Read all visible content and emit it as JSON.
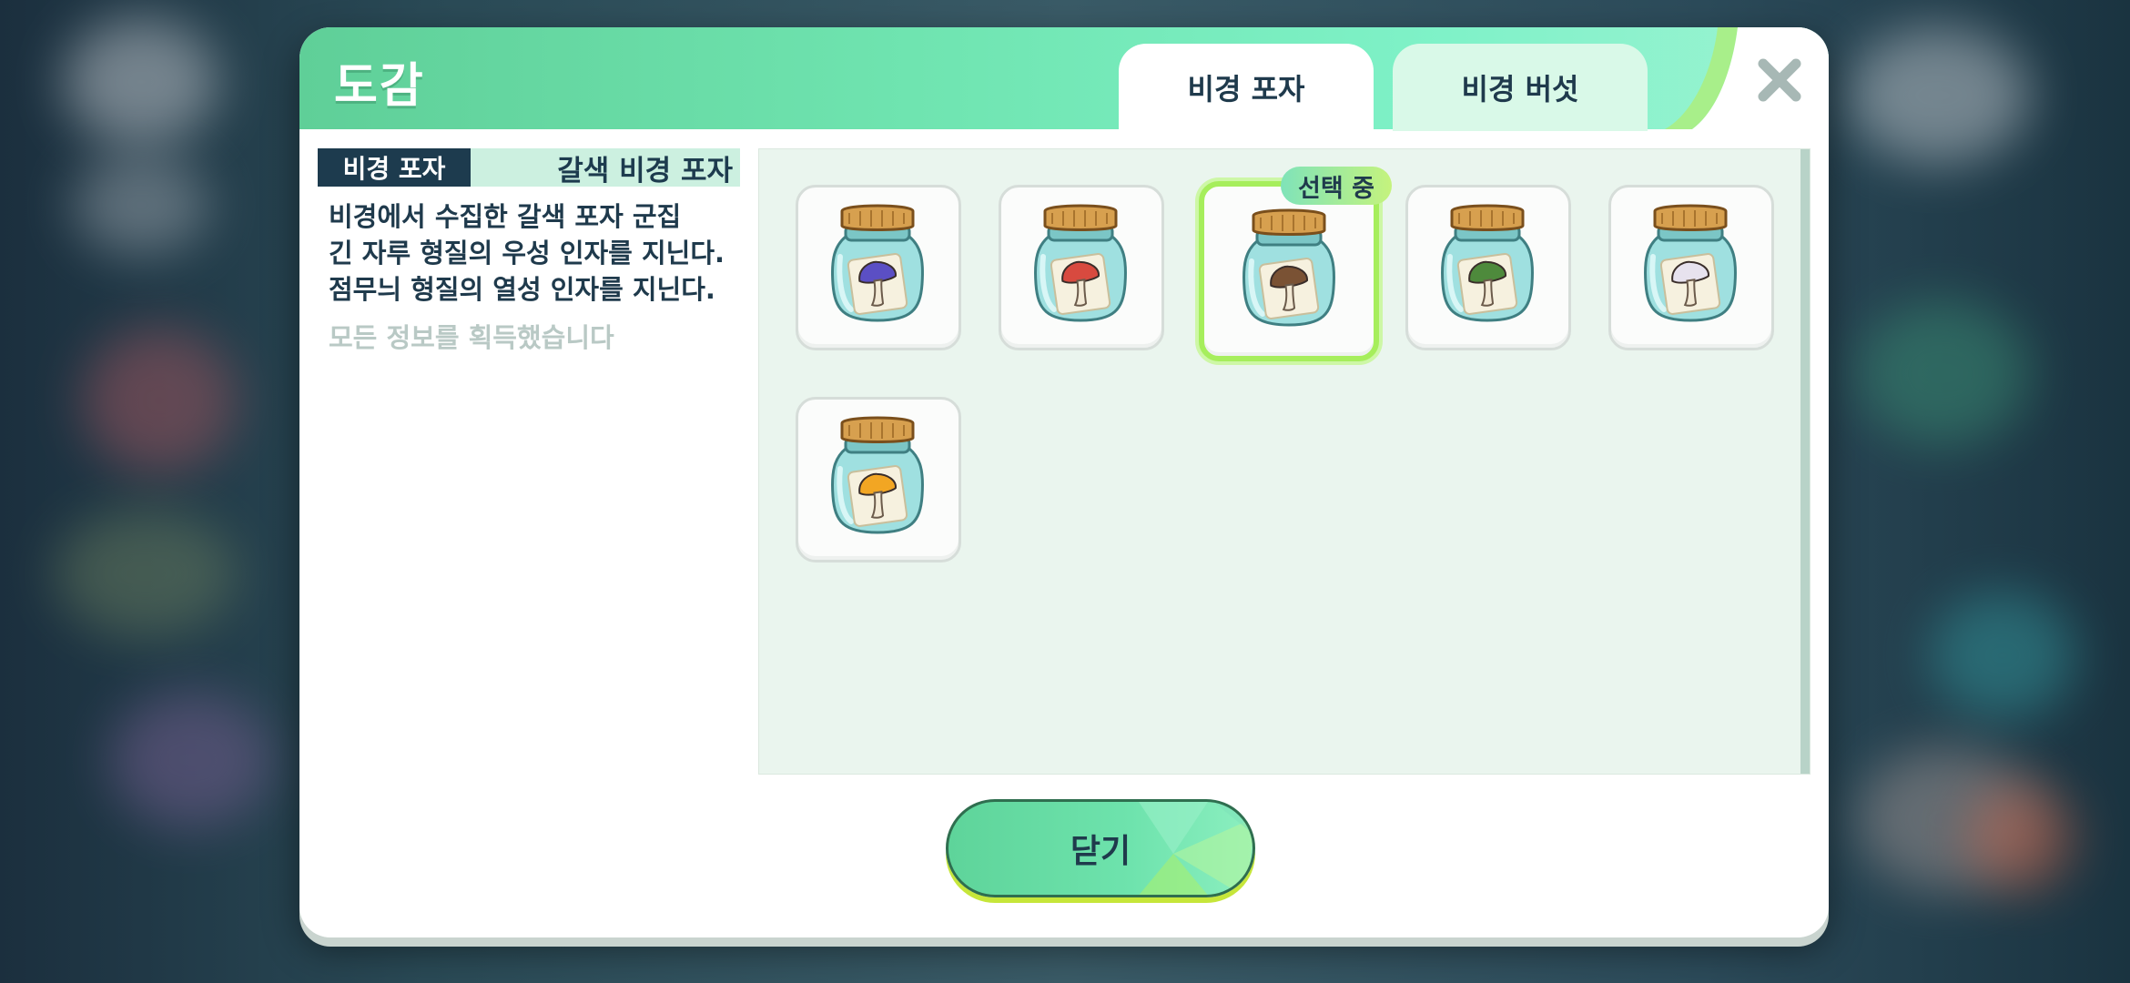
{
  "header": {
    "title": "도감",
    "tabs": [
      {
        "label": "비경 포자",
        "active": true
      },
      {
        "label": "비경 버섯",
        "active": false
      }
    ]
  },
  "detail": {
    "category_tag": "비경 포자",
    "item_name": "갈색 비경 포자",
    "description_lines": [
      "비경에서 수집한 갈색 포자 군집",
      "긴 자루 형질의 우성 인자를 지닌다.",
      "점무늬 형질의 열성 인자를 지닌다."
    ],
    "status": "모든 정보를 획득했습니다"
  },
  "grid": {
    "selected_badge": "선택 중",
    "items": [
      {
        "icon": "purple-mushroom-jar-icon",
        "cap_color": "#5b4fc4",
        "selected": false
      },
      {
        "icon": "red-mushroom-jar-icon",
        "cap_color": "#d84a3f",
        "selected": false
      },
      {
        "icon": "brown-mushroom-jar-icon",
        "cap_color": "#7a5234",
        "selected": true
      },
      {
        "icon": "green-mushroom-jar-icon",
        "cap_color": "#4e8a3c",
        "selected": false
      },
      {
        "icon": "white-mushroom-jar-icon",
        "cap_color": "#e7e2ee",
        "selected": false
      },
      {
        "icon": "orange-mushroom-jar-icon",
        "cap_color": "#f2a623",
        "selected": false
      }
    ]
  },
  "footer": {
    "close_label": "닫기"
  }
}
